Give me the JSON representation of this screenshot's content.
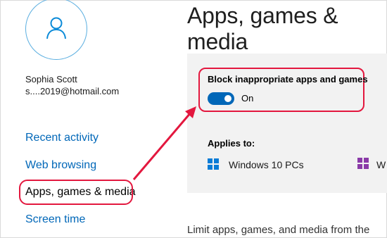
{
  "user": {
    "name": "Sophia Scott",
    "email": "s....2019@hotmail.com"
  },
  "nav": {
    "items": [
      {
        "label": "Recent activity"
      },
      {
        "label": "Web browsing"
      },
      {
        "label": "Apps, games & media"
      },
      {
        "label": "Screen time"
      }
    ],
    "active_index": 2
  },
  "main": {
    "title": "Apps, games & media",
    "setting": {
      "label": "Block inappropriate apps and games",
      "toggle_state": "On",
      "toggle_on": true
    },
    "applies_to": {
      "label": "Applies to:",
      "devices": [
        {
          "label": "Windows 10 PCs",
          "icon": "windows-icon"
        },
        {
          "label": "W",
          "icon": "xbox-console-icon"
        }
      ]
    },
    "description": "Limit apps, games, and media from the"
  },
  "colors": {
    "link": "#0067b8",
    "annotation": "#e3173e",
    "panel": "#f2f2f2",
    "toggle_on": "#0067b8"
  }
}
